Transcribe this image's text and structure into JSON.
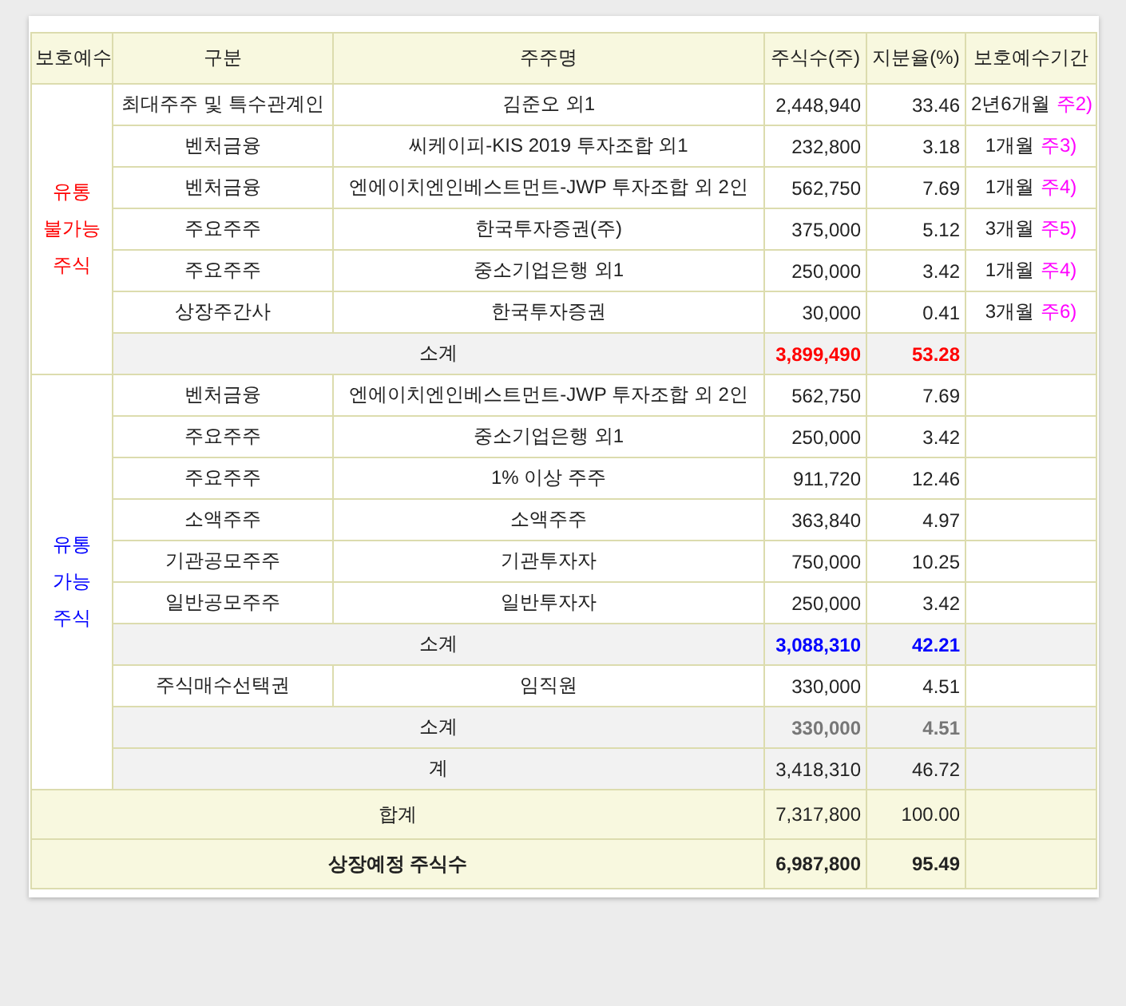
{
  "headers": [
    "보호예수",
    "구분",
    "주주명",
    "주식수(주)",
    "지분율(%)",
    "보호예수기간"
  ],
  "sections": [
    {
      "label": [
        "유통",
        "불가능",
        "주식"
      ],
      "color": "#ff0000",
      "rows": [
        {
          "kind": "item",
          "category": "최대주주 및 특수관계인",
          "holder": "김준오 외1",
          "shares": "2,448,940",
          "ratio": "33.46",
          "period": "2년6개월",
          "note": "주2)"
        },
        {
          "kind": "item",
          "category": "벤처금융",
          "holder": "씨케이피-KIS 2019 투자조합 외1",
          "shares": "232,800",
          "ratio": "3.18",
          "period": "1개월",
          "note": "주3)"
        },
        {
          "kind": "item",
          "category": "벤처금융",
          "holder": "엔에이치엔인베스트먼트-JWP 투자조합 외 2인",
          "shares": "562,750",
          "ratio": "7.69",
          "period": "1개월",
          "note": "주4)"
        },
        {
          "kind": "item",
          "category": "주요주주",
          "holder": "한국투자증권(주)",
          "shares": "375,000",
          "ratio": "5.12",
          "period": "3개월",
          "note": "주5)"
        },
        {
          "kind": "item",
          "category": "주요주주",
          "holder": "중소기업은행 외1",
          "shares": "250,000",
          "ratio": "3.42",
          "period": "1개월",
          "note": "주4)"
        },
        {
          "kind": "item",
          "category": "상장주간사",
          "holder": "한국투자증권",
          "shares": "30,000",
          "ratio": "0.41",
          "period": "3개월",
          "note": "주6)"
        },
        {
          "kind": "subtotal",
          "label": "소계",
          "shares": "3,899,490",
          "ratio": "53.28",
          "color": "#ff0000"
        }
      ]
    },
    {
      "label": [
        "유통",
        "가능",
        "주식"
      ],
      "color": "#0000ff",
      "rows": [
        {
          "kind": "item",
          "category": "벤처금융",
          "holder": "엔에이치엔인베스트먼트-JWP 투자조합 외 2인",
          "shares": "562,750",
          "ratio": "7.69"
        },
        {
          "kind": "item",
          "category": "주요주주",
          "holder": "중소기업은행 외1",
          "shares": "250,000",
          "ratio": "3.42"
        },
        {
          "kind": "item",
          "category": "주요주주",
          "holder": "1% 이상 주주",
          "shares": "911,720",
          "ratio": "12.46"
        },
        {
          "kind": "item",
          "category": "소액주주",
          "holder": "소액주주",
          "shares": "363,840",
          "ratio": "4.97"
        },
        {
          "kind": "item",
          "category": "기관공모주주",
          "holder": "기관투자자",
          "shares": "750,000",
          "ratio": "10.25"
        },
        {
          "kind": "item",
          "category": "일반공모주주",
          "holder": "일반투자자",
          "shares": "250,000",
          "ratio": "3.42"
        },
        {
          "kind": "subtotal",
          "label": "소계",
          "shares": "3,088,310",
          "ratio": "42.21",
          "color": "#0000ff"
        },
        {
          "kind": "item",
          "category": "주식매수선택권",
          "holder": "임직원",
          "shares": "330,000",
          "ratio": "4.51"
        },
        {
          "kind": "subtotal",
          "label": "소계",
          "shares": "330,000",
          "ratio": "4.51",
          "color": "#777777"
        },
        {
          "kind": "total",
          "label": "계",
          "shares": "3,418,310",
          "ratio": "46.72"
        }
      ]
    }
  ],
  "totals": [
    {
      "label": "합계",
      "shares": "7,317,800",
      "ratio": "100.00",
      "bold": false
    },
    {
      "label": "상장예정 주식수",
      "shares": "6,987,800",
      "ratio": "95.49",
      "bold": true
    }
  ]
}
